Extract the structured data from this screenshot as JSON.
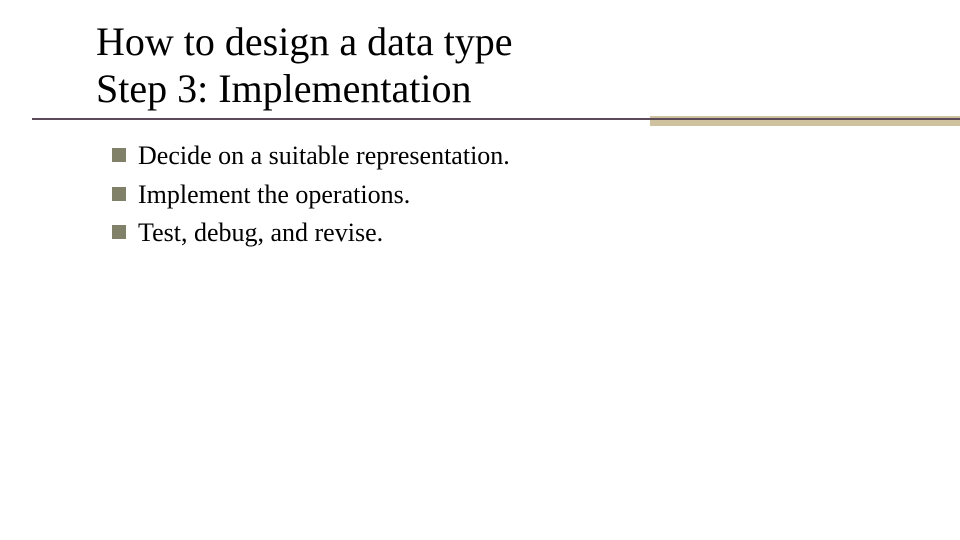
{
  "title": {
    "line1": "How to design a data type",
    "line2": "Step 3: Implementation"
  },
  "bullets": [
    "Decide on a suitable representation.",
    "Implement the operations.",
    "Test, debug, and revise."
  ],
  "colors": {
    "bullet": "#81816a",
    "rule_dark": "#5b4a57",
    "rule_accent": "#cfc39f"
  }
}
